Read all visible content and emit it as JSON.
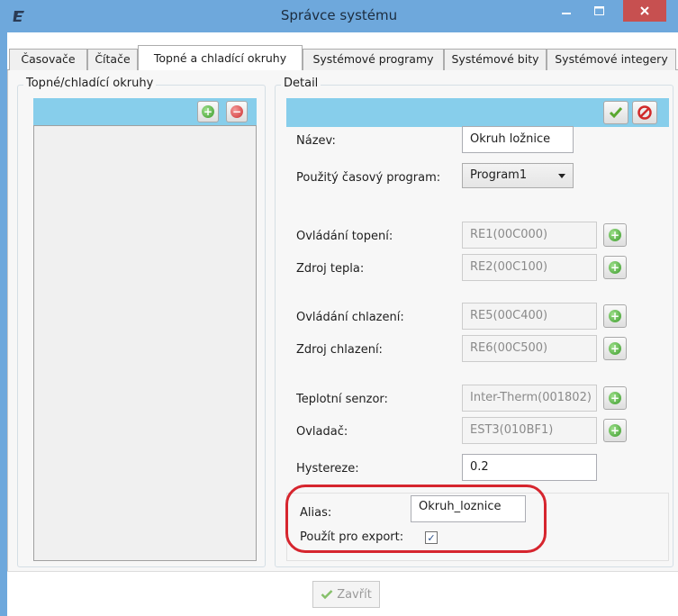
{
  "window": {
    "title": "Správce systému",
    "app_icon": "e-logo-icon"
  },
  "tabs": [
    {
      "label": "Časovače"
    },
    {
      "label": "Čítače"
    },
    {
      "label": "Topné a chladící okruhy"
    },
    {
      "label": "Systémové programy"
    },
    {
      "label": "Systémové bity"
    },
    {
      "label": "Systémové integery"
    }
  ],
  "left_panel": {
    "title": "Topné/chladící okruhy"
  },
  "detail": {
    "title": "Detail",
    "fields": {
      "nazev": {
        "label": "Název:",
        "value": "Okruh ložnice"
      },
      "program": {
        "label": "Použitý časový program:",
        "value": "Program1"
      },
      "ovladani_topeni": {
        "label": "Ovládání topení:",
        "value": "RE1(00C000)"
      },
      "zdroj_tepla": {
        "label": "Zdroj tepla:",
        "value": "RE2(00C100)"
      },
      "ovladani_chlazeni": {
        "label": "Ovládání chlazení:",
        "value": "RE5(00C400)"
      },
      "zdroj_chlazeni": {
        "label": "Zdroj chlazení:",
        "value": "RE6(00C500)"
      },
      "teplotni_senzor": {
        "label": "Teplotní senzor:",
        "value": "Inter-Therm(001802)"
      },
      "ovladac": {
        "label": "Ovladač:",
        "value": "EST3(010BF1)"
      },
      "hystereze": {
        "label": "Hystereze:",
        "value": "0.2"
      },
      "alias": {
        "label": "Alias:",
        "value": "Okruh_loznice"
      },
      "export": {
        "label": "Použít pro export:",
        "checked": true
      }
    }
  },
  "footer": {
    "close_label": "Zavřít"
  },
  "colors": {
    "title_bar": "#6ea8dc",
    "panel_header": "#87ceeb",
    "highlight": "#d6252e",
    "close_button": "#c75050"
  }
}
